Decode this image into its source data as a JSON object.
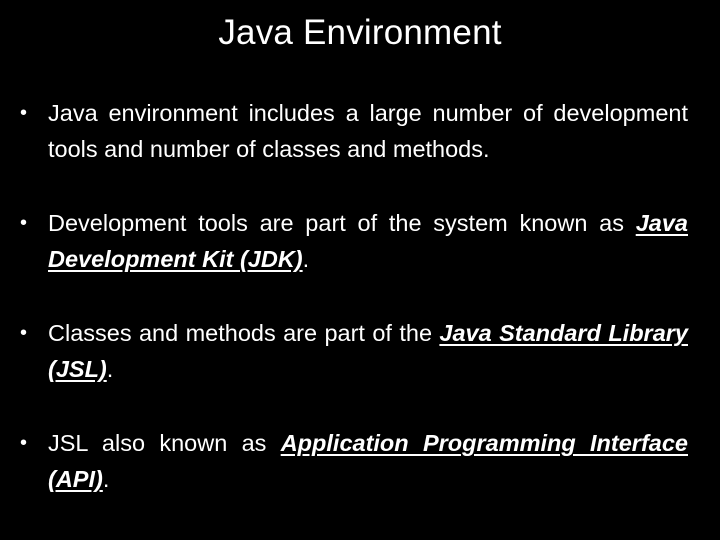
{
  "slide": {
    "title": "Java Environment",
    "bullet_glyph": "•",
    "bullets": [
      {
        "segments": [
          {
            "text": "Java environment includes a large number of development tools and number of classes and methods.",
            "emphasis": false
          }
        ]
      },
      {
        "segments": [
          {
            "text": "Development tools are part of the system known as ",
            "emphasis": false
          },
          {
            "text": "Java Development Kit (JDK)",
            "emphasis": true
          },
          {
            "text": ".",
            "emphasis": false
          }
        ]
      },
      {
        "segments": [
          {
            "text": "Classes and methods are part of the ",
            "emphasis": false
          },
          {
            "text": "Java Standard Library (JSL)",
            "emphasis": true
          },
          {
            "text": ".",
            "emphasis": false
          }
        ]
      },
      {
        "segments": [
          {
            "text": "JSL also known as ",
            "emphasis": false
          },
          {
            "text": "Application Programming Interface (API)",
            "emphasis": true
          },
          {
            "text": ".",
            "emphasis": false
          }
        ]
      }
    ]
  },
  "colors": {
    "background": "#000000",
    "text": "#ffffff"
  }
}
